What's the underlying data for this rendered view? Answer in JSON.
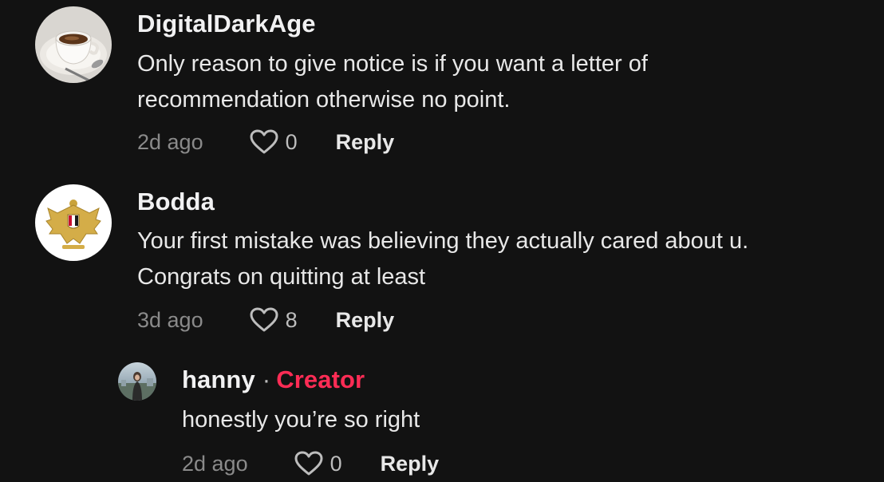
{
  "comments": [
    {
      "username": "DigitalDarkAge",
      "avatar_icon": "coffee-cup-avatar",
      "text_lines": [
        "Only reason to give notice is if you want a letter of",
        "recommendation otherwise no point."
      ],
      "time": "2d ago",
      "likes": "0",
      "reply_label": "Reply"
    },
    {
      "username": "Bodda",
      "avatar_icon": "eagle-emblem-avatar",
      "text_lines": [
        "Your first mistake was believing they actually cared about u.",
        "Congrats on quitting at least"
      ],
      "time": "3d ago",
      "likes": "8",
      "reply_label": "Reply"
    }
  ],
  "reply": {
    "username": "hanny",
    "separator": "·",
    "badge": "Creator",
    "avatar_icon": "person-photo-avatar",
    "text": "honestly you’re so right",
    "time": "2d ago",
    "likes": "0",
    "reply_label": "Reply"
  },
  "colors": {
    "background": "#121212",
    "creator_badge": "#fe2c55",
    "muted": "#8a8a8a"
  },
  "icons": {
    "like": "heart-outline-icon"
  }
}
